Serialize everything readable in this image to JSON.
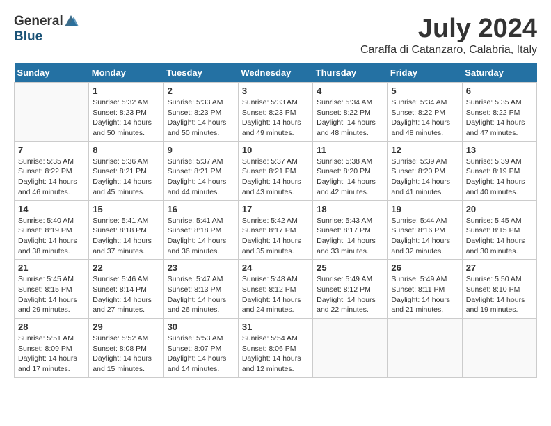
{
  "header": {
    "logo_general": "General",
    "logo_blue": "Blue",
    "month_title": "July 2024",
    "location": "Caraffa di Catanzaro, Calabria, Italy"
  },
  "days_of_week": [
    "Sunday",
    "Monday",
    "Tuesday",
    "Wednesday",
    "Thursday",
    "Friday",
    "Saturday"
  ],
  "weeks": [
    [
      {
        "day": "",
        "detail": ""
      },
      {
        "day": "1",
        "detail": "Sunrise: 5:32 AM\nSunset: 8:23 PM\nDaylight: 14 hours\nand 50 minutes."
      },
      {
        "day": "2",
        "detail": "Sunrise: 5:33 AM\nSunset: 8:23 PM\nDaylight: 14 hours\nand 50 minutes."
      },
      {
        "day": "3",
        "detail": "Sunrise: 5:33 AM\nSunset: 8:23 PM\nDaylight: 14 hours\nand 49 minutes."
      },
      {
        "day": "4",
        "detail": "Sunrise: 5:34 AM\nSunset: 8:22 PM\nDaylight: 14 hours\nand 48 minutes."
      },
      {
        "day": "5",
        "detail": "Sunrise: 5:34 AM\nSunset: 8:22 PM\nDaylight: 14 hours\nand 48 minutes."
      },
      {
        "day": "6",
        "detail": "Sunrise: 5:35 AM\nSunset: 8:22 PM\nDaylight: 14 hours\nand 47 minutes."
      }
    ],
    [
      {
        "day": "7",
        "detail": "Sunrise: 5:35 AM\nSunset: 8:22 PM\nDaylight: 14 hours\nand 46 minutes."
      },
      {
        "day": "8",
        "detail": "Sunrise: 5:36 AM\nSunset: 8:21 PM\nDaylight: 14 hours\nand 45 minutes."
      },
      {
        "day": "9",
        "detail": "Sunrise: 5:37 AM\nSunset: 8:21 PM\nDaylight: 14 hours\nand 44 minutes."
      },
      {
        "day": "10",
        "detail": "Sunrise: 5:37 AM\nSunset: 8:21 PM\nDaylight: 14 hours\nand 43 minutes."
      },
      {
        "day": "11",
        "detail": "Sunrise: 5:38 AM\nSunset: 8:20 PM\nDaylight: 14 hours\nand 42 minutes."
      },
      {
        "day": "12",
        "detail": "Sunrise: 5:39 AM\nSunset: 8:20 PM\nDaylight: 14 hours\nand 41 minutes."
      },
      {
        "day": "13",
        "detail": "Sunrise: 5:39 AM\nSunset: 8:19 PM\nDaylight: 14 hours\nand 40 minutes."
      }
    ],
    [
      {
        "day": "14",
        "detail": "Sunrise: 5:40 AM\nSunset: 8:19 PM\nDaylight: 14 hours\nand 38 minutes."
      },
      {
        "day": "15",
        "detail": "Sunrise: 5:41 AM\nSunset: 8:18 PM\nDaylight: 14 hours\nand 37 minutes."
      },
      {
        "day": "16",
        "detail": "Sunrise: 5:41 AM\nSunset: 8:18 PM\nDaylight: 14 hours\nand 36 minutes."
      },
      {
        "day": "17",
        "detail": "Sunrise: 5:42 AM\nSunset: 8:17 PM\nDaylight: 14 hours\nand 35 minutes."
      },
      {
        "day": "18",
        "detail": "Sunrise: 5:43 AM\nSunset: 8:17 PM\nDaylight: 14 hours\nand 33 minutes."
      },
      {
        "day": "19",
        "detail": "Sunrise: 5:44 AM\nSunset: 8:16 PM\nDaylight: 14 hours\nand 32 minutes."
      },
      {
        "day": "20",
        "detail": "Sunrise: 5:45 AM\nSunset: 8:15 PM\nDaylight: 14 hours\nand 30 minutes."
      }
    ],
    [
      {
        "day": "21",
        "detail": "Sunrise: 5:45 AM\nSunset: 8:15 PM\nDaylight: 14 hours\nand 29 minutes."
      },
      {
        "day": "22",
        "detail": "Sunrise: 5:46 AM\nSunset: 8:14 PM\nDaylight: 14 hours\nand 27 minutes."
      },
      {
        "day": "23",
        "detail": "Sunrise: 5:47 AM\nSunset: 8:13 PM\nDaylight: 14 hours\nand 26 minutes."
      },
      {
        "day": "24",
        "detail": "Sunrise: 5:48 AM\nSunset: 8:12 PM\nDaylight: 14 hours\nand 24 minutes."
      },
      {
        "day": "25",
        "detail": "Sunrise: 5:49 AM\nSunset: 8:12 PM\nDaylight: 14 hours\nand 22 minutes."
      },
      {
        "day": "26",
        "detail": "Sunrise: 5:49 AM\nSunset: 8:11 PM\nDaylight: 14 hours\nand 21 minutes."
      },
      {
        "day": "27",
        "detail": "Sunrise: 5:50 AM\nSunset: 8:10 PM\nDaylight: 14 hours\nand 19 minutes."
      }
    ],
    [
      {
        "day": "28",
        "detail": "Sunrise: 5:51 AM\nSunset: 8:09 PM\nDaylight: 14 hours\nand 17 minutes."
      },
      {
        "day": "29",
        "detail": "Sunrise: 5:52 AM\nSunset: 8:08 PM\nDaylight: 14 hours\nand 15 minutes."
      },
      {
        "day": "30",
        "detail": "Sunrise: 5:53 AM\nSunset: 8:07 PM\nDaylight: 14 hours\nand 14 minutes."
      },
      {
        "day": "31",
        "detail": "Sunrise: 5:54 AM\nSunset: 8:06 PM\nDaylight: 14 hours\nand 12 minutes."
      },
      {
        "day": "",
        "detail": ""
      },
      {
        "day": "",
        "detail": ""
      },
      {
        "day": "",
        "detail": ""
      }
    ]
  ]
}
